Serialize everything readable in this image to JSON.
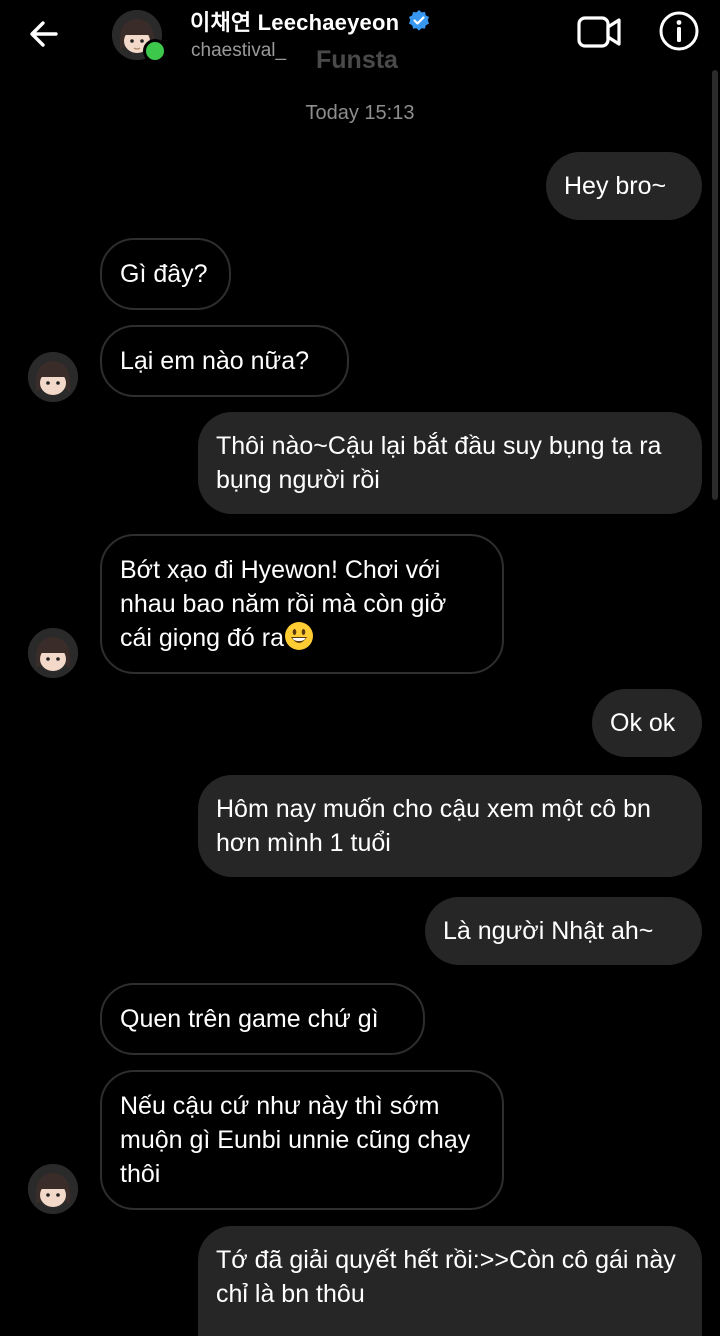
{
  "header": {
    "name": "이채연 Leechaeyeon",
    "username": "chaestival_",
    "tag": "Funsta",
    "back_icon": "arrow-left-icon",
    "video_icon": "video-camera-icon",
    "info_icon": "info-icon",
    "online_color": "#3cc84a",
    "verified_color": "#3897f0"
  },
  "timestamp": "Today 15:13",
  "messages": [
    {
      "from": "me",
      "text": "Hey bro~"
    },
    {
      "from": "them",
      "text": "Gì đây?"
    },
    {
      "from": "them",
      "text": "Lại em nào nữa?"
    },
    {
      "from": "me",
      "text": "Thôi nào~Cậu lại bắt đầu suy bụng ta ra bụng người rồi"
    },
    {
      "from": "them",
      "text": "Bớt xạo đi Hyewon! Chơi với nhau bao năm rồi mà còn giở cái giọng đó ra"
    },
    {
      "from": "me",
      "text": "Ok ok"
    },
    {
      "from": "me",
      "text": "Hôm nay muốn cho cậu xem một cô bn hơn mình 1 tuổi"
    },
    {
      "from": "me",
      "text": "Là người Nhật ah~"
    },
    {
      "from": "them",
      "text": "Quen trên game chứ gì"
    },
    {
      "from": "them",
      "text": "Nếu cậu cứ như này thì sớm muộn gì Eunbi unnie cũng chạy thôi"
    },
    {
      "from": "me",
      "text": "Tớ đã giải quyết hết rồi:>>Còn cô gái này chỉ là bn thôu"
    }
  ],
  "colors": {
    "background": "#000000",
    "sent_bubble": "#262626",
    "received_border": "#2e2e2e",
    "timestamp": "#8e8e8e"
  }
}
